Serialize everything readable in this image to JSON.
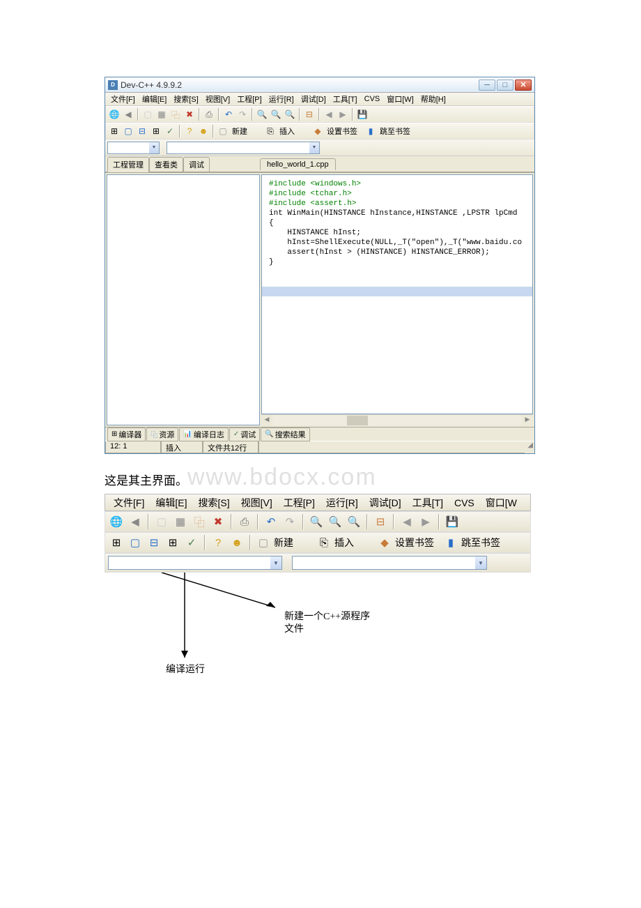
{
  "window_title": "Dev-C++ 4.9.9.2",
  "menus": [
    "文件[F]",
    "编辑[E]",
    "搜索[S]",
    "视图[V]",
    "工程[P]",
    "运行[R]",
    "调试[D]",
    "工具[T]",
    "CVS",
    "窗口[W]",
    "帮助[H]"
  ],
  "toolbar2": {
    "new": "新建",
    "insert": "插入",
    "set_bm": "设置书签",
    "goto_bm": "跳至书签"
  },
  "sidebar_tabs": [
    "工程管理",
    "查看类",
    "调试"
  ],
  "file_tab": "hello_world_1.cpp",
  "code": [
    "#include <windows.h>",
    "#include <tchar.h>",
    "#include <assert.h>",
    "",
    "int WinMain(HINSTANCE hInstance,HINSTANCE ,LPSTR lpCmd",
    "{",
    "    HINSTANCE hInst;",
    "    hInst=ShellExecute(NULL,_T(\"open\"),_T(\"www.baidu.co",
    "    assert(hInst > (HINSTANCE) HINSTANCE_ERROR);",
    "}"
  ],
  "bottom_tabs": [
    "编译器",
    "资源",
    "编译日志",
    "调试",
    "搜索结果"
  ],
  "status": {
    "pos": "12: 1",
    "mode": "插入",
    "lines": "文件共12行"
  },
  "caption": "这是其主界面。",
  "watermark": "www.bdocx.com",
  "big_menus": [
    "文件[F]",
    "编辑[E]",
    "搜索[S]",
    "视图[V]",
    "工程[P]",
    "运行[R]",
    "调试[D]",
    "工具[T]",
    "CVS",
    "窗口[W"
  ],
  "anno1": "新建一个C++源程序",
  "anno1b": "文件",
  "anno2": "编译运行"
}
